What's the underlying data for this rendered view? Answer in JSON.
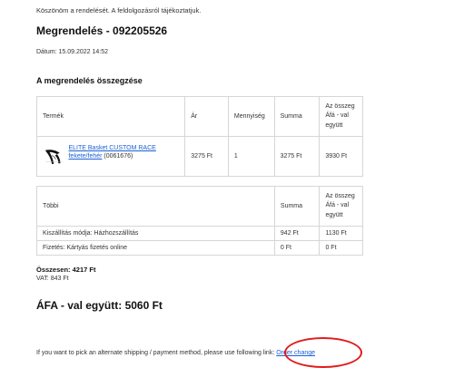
{
  "thanks_text": "Köszönöm a rendelését. A feldolgozásról tájékoztatjuk.",
  "order_title": "Megrendelés - 092205526",
  "date_text": "Dátum: 15.09.2022 14:52",
  "summary_title": "A megrendelés összegzése",
  "products_table": {
    "headers": {
      "product": "Termék",
      "price": "Ár",
      "quantity": "Mennyiség",
      "sum": "Summa",
      "total_vat": "Az összeg Áfá - val együtt"
    },
    "row": {
      "product_name": "ELITE Basket CUSTOM RACE fekete/fehér",
      "product_code": "(0061676)",
      "price": "3275 Ft",
      "quantity": "1",
      "sum": "3275 Ft",
      "total_vat": "3930 Ft"
    }
  },
  "other_table": {
    "headers": {
      "other": "Többi",
      "sum": "Summa",
      "total_vat": "Az összeg Áfá - val együtt"
    },
    "rows": [
      {
        "label": "Kiszállítás módja: Házhozszállítás",
        "sum": "942 Ft",
        "total_vat": "1130 Ft"
      },
      {
        "label": "Fizetés: Kártyás fizetés online",
        "sum": "0 Ft",
        "total_vat": "0 Ft"
      }
    ]
  },
  "total_text": "Összesen: 4217 Ft",
  "vat_text": "VAT: 843 Ft",
  "grand_total_text": "ÁFA - val együtt: 5060 Ft",
  "ship_note": "If you want to pick an alternate shipping / payment method, please use following link:",
  "order_change_link": "Order change",
  "product_icon": "bottle-cage-image",
  "colors": {
    "link": "#1a5fd6",
    "highlight_circle": "#e21b1b"
  }
}
